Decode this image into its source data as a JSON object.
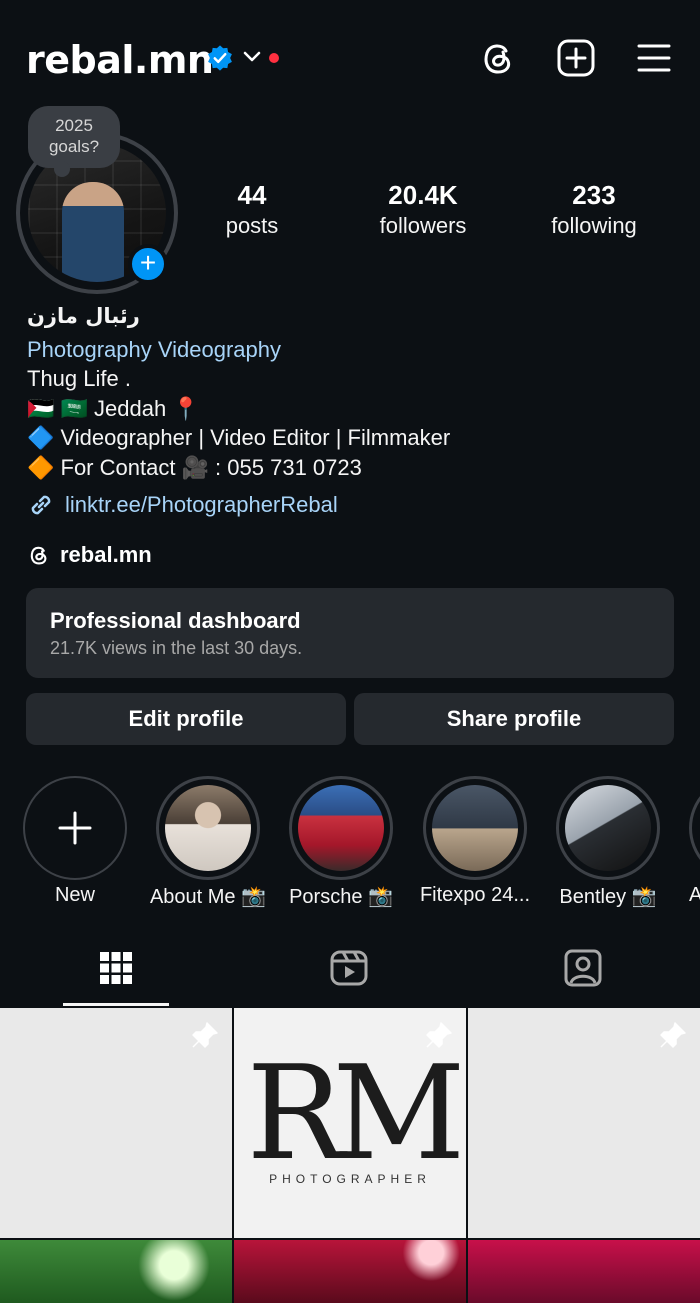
{
  "header": {
    "username": "rebal.mn",
    "icons": [
      "verified-badge-icon",
      "chevron-down-icon",
      "threads-icon",
      "create-icon",
      "menu-icon"
    ],
    "accent_color": "#0095f6",
    "notification_dot_color": "#ff3040"
  },
  "profile": {
    "note": "2025 goals?",
    "stats": [
      {
        "value": "44",
        "label": "posts"
      },
      {
        "value": "20.4K",
        "label": "followers"
      },
      {
        "value": "233",
        "label": "following"
      }
    ],
    "display_name": "رئبال مازن",
    "category": "Photography Videography",
    "bio_lines": [
      "Thug Life .",
      "🇵🇸 🇸🇦 Jeddah 📍",
      "🔷 Videographer | Video Editor | Filmmaker",
      "🔶 For Contact 🎥 : 055 731 0723"
    ],
    "link": "linktr.ee/PhotographerRebal",
    "threads_handle": "rebal.mn"
  },
  "dashboard": {
    "title": "Professional dashboard",
    "subtitle": "21.7K views in the last 30 days."
  },
  "buttons": {
    "edit": "Edit profile",
    "share": "Share profile"
  },
  "highlights": [
    {
      "label": "New"
    },
    {
      "label": "About Me 📸"
    },
    {
      "label": "Porsche 📸"
    },
    {
      "label": "Fitexpo 24..."
    },
    {
      "label": "Bentley 📸"
    },
    {
      "label": "A"
    }
  ],
  "tabs": [
    "grid-icon",
    "reels-icon",
    "tagged-icon"
  ],
  "grid": {
    "logo_main": "RM",
    "logo_sub": "PHOTOGRAPHER"
  }
}
